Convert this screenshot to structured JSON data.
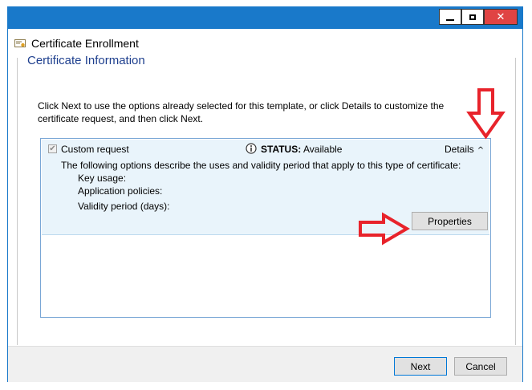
{
  "window": {
    "title": "Certificate Enrollment",
    "buttons": {
      "minimize": "minimize-icon",
      "maximize": "maximize-icon",
      "close": "close-icon"
    },
    "accent_color": "#1979ca"
  },
  "page": {
    "section_title": "Certificate Information",
    "intro_text": "Click Next to use the options already selected for this template, or click Details to customize the certificate request, and then click Next."
  },
  "list": {
    "items": [
      {
        "checked": true,
        "name": "Custom request",
        "status_label": "STATUS:",
        "status_value": "Available",
        "details_label": "Details",
        "description": "The following options describe the uses and validity period that apply to this type of certificate:",
        "fields": [
          {
            "label": "Key usage:",
            "value": ""
          },
          {
            "label": "Application policies:",
            "value": ""
          },
          {
            "label": "Validity period (days):",
            "value": ""
          }
        ],
        "properties_label": "Properties"
      }
    ]
  },
  "footer": {
    "next_label": "Next",
    "cancel_label": "Cancel"
  },
  "annotations": {
    "arrow_color": "#e8232b"
  }
}
